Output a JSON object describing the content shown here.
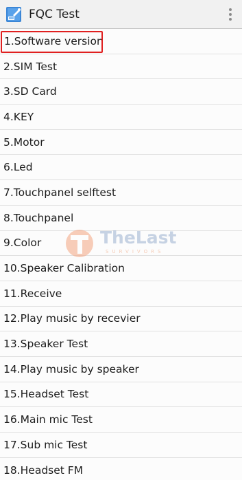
{
  "header": {
    "title": "FQC Test",
    "icon": "fqc-app-icon",
    "menu_icon": "overflow-menu-icon"
  },
  "list": {
    "items": [
      {
        "label": "1.Software version"
      },
      {
        "label": "2.SIM Test"
      },
      {
        "label": "3.SD Card"
      },
      {
        "label": "4.KEY"
      },
      {
        "label": "5.Motor"
      },
      {
        "label": "6.Led"
      },
      {
        "label": "7.Touchpanel selftest"
      },
      {
        "label": "8.Touchpanel"
      },
      {
        "label": "9.Color"
      },
      {
        "label": "10.Speaker Calibration"
      },
      {
        "label": "11.Receive"
      },
      {
        "label": "12.Play music by recevier"
      },
      {
        "label": "13.Speaker Test"
      },
      {
        "label": "14.Play music by speaker"
      },
      {
        "label": "15.Headset Test"
      },
      {
        "label": "16.Main mic Test"
      },
      {
        "label": "17.Sub mic Test"
      },
      {
        "label": "18.Headset FM"
      }
    ],
    "highlighted_index": 0
  },
  "watermark": {
    "text": "TheLast",
    "subtext": "SURVIVORS"
  },
  "colors": {
    "highlight": "#e02020",
    "actionbar": "#f1f1f1"
  }
}
